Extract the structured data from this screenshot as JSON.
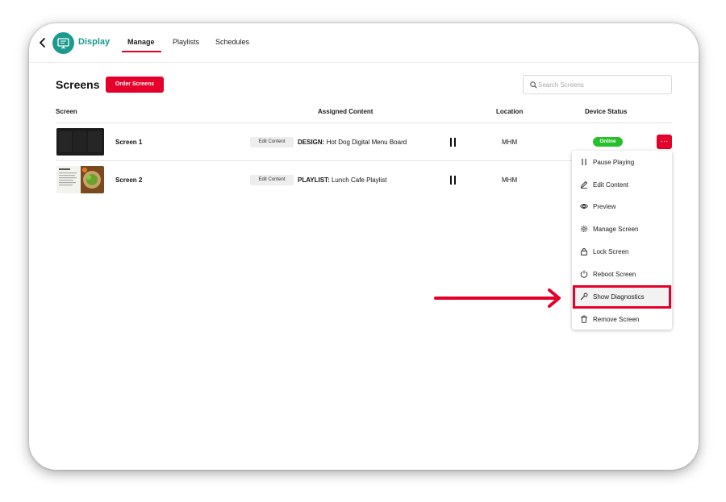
{
  "header": {
    "app_name": "Display",
    "tabs": [
      {
        "label": "Manage",
        "active": true
      },
      {
        "label": "Playlists",
        "active": false
      },
      {
        "label": "Schedules",
        "active": false
      }
    ]
  },
  "page": {
    "title": "Screens",
    "order_button": "Order Screens",
    "search_placeholder": "Search Screens"
  },
  "table": {
    "columns": [
      "Screen",
      "Assigned Content",
      "Location",
      "Device Status"
    ],
    "rows": [
      {
        "name": "Screen 1",
        "edit_label": "Edit Content",
        "content_type": "DESIGN:",
        "content_name": "Hot Dog Digital Menu Board",
        "location": "MHM",
        "status": "Online"
      },
      {
        "name": "Screen 2",
        "edit_label": "Edit Content",
        "content_type": "PLAYLIST:",
        "content_name": "Lunch Cafe Playlist",
        "location": "MHM",
        "status": ""
      }
    ],
    "more_button": "···"
  },
  "menu": {
    "items": [
      {
        "label": "Pause Playing",
        "icon": "pause-icon"
      },
      {
        "label": "Edit Content",
        "icon": "pencil-icon"
      },
      {
        "label": "Preview",
        "icon": "eye-icon"
      },
      {
        "label": "Manage Screen",
        "icon": "gear-icon"
      },
      {
        "label": "Lock Screen",
        "icon": "lock-icon"
      },
      {
        "label": "Reboot Screen",
        "icon": "power-icon"
      },
      {
        "label": "Show Diagnostics",
        "icon": "wrench-icon"
      },
      {
        "label": "Remove Screen",
        "icon": "trash-icon"
      }
    ],
    "highlighted": "Show Diagnostics"
  },
  "colors": {
    "brand_teal": "#1b9a8d",
    "accent_red": "#e4002b",
    "status_green": "#25c02a"
  }
}
